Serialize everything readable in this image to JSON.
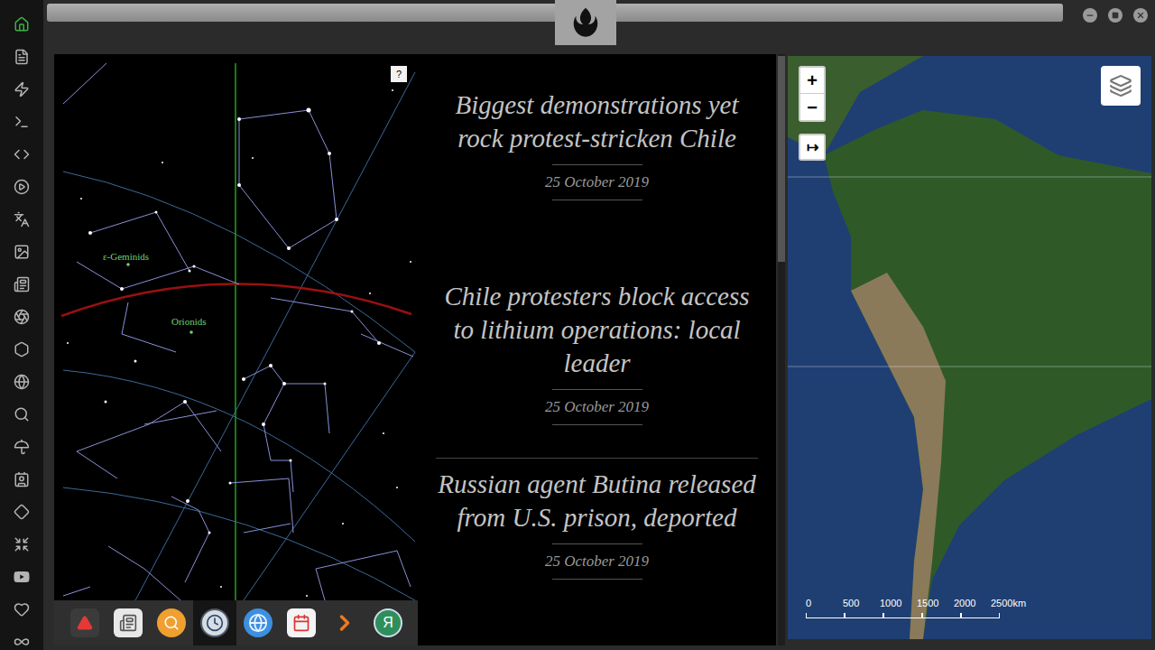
{
  "sidebar": {
    "items": [
      {
        "selected": true
      },
      {
        "selected": false
      },
      {
        "selected": false
      },
      {
        "selected": false
      },
      {
        "selected": false
      },
      {
        "selected": false
      },
      {
        "selected": false
      },
      {
        "selected": false
      },
      {
        "selected": false
      },
      {
        "selected": false
      },
      {
        "selected": false
      },
      {
        "selected": false
      },
      {
        "selected": false
      },
      {
        "selected": false
      },
      {
        "selected": false
      },
      {
        "selected": false
      },
      {
        "selected": false
      },
      {
        "selected": false
      },
      {
        "selected": false
      },
      {
        "selected": false
      }
    ]
  },
  "sky_chart": {
    "help": "?",
    "showers": [
      {
        "name": "ε-Geminids"
      },
      {
        "name": "Orionids"
      }
    ]
  },
  "dock": {
    "apps": [
      {
        "selected": false
      },
      {
        "selected": false
      },
      {
        "selected": false
      },
      {
        "selected": true
      },
      {
        "selected": false
      },
      {
        "selected": false
      },
      {
        "selected": false
      },
      {
        "selected": false,
        "label": "Я"
      }
    ]
  },
  "news": [
    {
      "title": "Biggest demonstrations yet rock protest-stricken Chile",
      "date": "25 October 2019"
    },
    {
      "title": "Chile protesters block access to lithium operations: local leader",
      "date": "25 October 2019"
    },
    {
      "title": "Russian agent Butina released from U.S. prison, deported",
      "date": "25 October 2019"
    }
  ],
  "map": {
    "zoom_in": "+",
    "zoom_out": "−",
    "expand": "↦",
    "scale": [
      "0",
      "500",
      "1000",
      "1500",
      "2000",
      "2500km"
    ]
  }
}
